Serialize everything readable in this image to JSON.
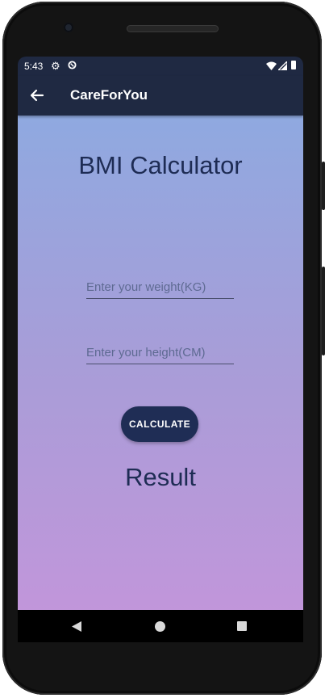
{
  "status_bar": {
    "time": "5:43",
    "icons": [
      "gear-icon",
      "sync-icon",
      "wifi-icon",
      "cell-signal-icon",
      "battery-icon"
    ]
  },
  "app_bar": {
    "title": "CareForYou",
    "nav_icon": "back-arrow-icon"
  },
  "main": {
    "heading": "BMI Calculator",
    "weight_placeholder": "Enter your weight(KG)",
    "weight_value": "",
    "height_placeholder": "Enter your height(CM)",
    "height_value": "",
    "calculate_label": "CALCULATE",
    "result_label": "Result"
  },
  "nav_bar": {
    "icons": [
      "nav-back-icon",
      "nav-home-icon",
      "nav-recents-icon"
    ]
  },
  "colors": {
    "app_bar": "#1f2942",
    "accent": "#1f2d55",
    "gradient_top": "#8fa9e0",
    "gradient_bottom": "#c196da",
    "text": "#1e2c54"
  }
}
